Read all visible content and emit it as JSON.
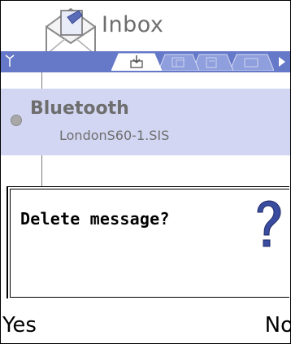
{
  "header": {
    "title": "Inbox",
    "icon": "envelope-icon"
  },
  "tabs": {
    "signal_icon": "signal-icon",
    "items": [
      {
        "icon": "inbox-download-icon",
        "active": true
      },
      {
        "icon": "tab-icon-2",
        "active": false
      },
      {
        "icon": "tab-icon-3",
        "active": false
      },
      {
        "icon": "tab-icon-4",
        "active": false
      }
    ],
    "scroll_icon": "right-arrow-icon"
  },
  "message_list": {
    "items": [
      {
        "title": "Bluetooth",
        "subtitle": "LondonS60-1.SIS",
        "selected": true
      }
    ]
  },
  "dialog": {
    "text": "Delete message?",
    "icon": "question-icon"
  },
  "softkeys": {
    "left": "Yes",
    "right": "No"
  },
  "colors": {
    "tab_strip": "#6678c8",
    "selected_row": "#d2d6f2",
    "question_mark": "#2a3a8c",
    "text_gray": "#6e6e6e"
  }
}
